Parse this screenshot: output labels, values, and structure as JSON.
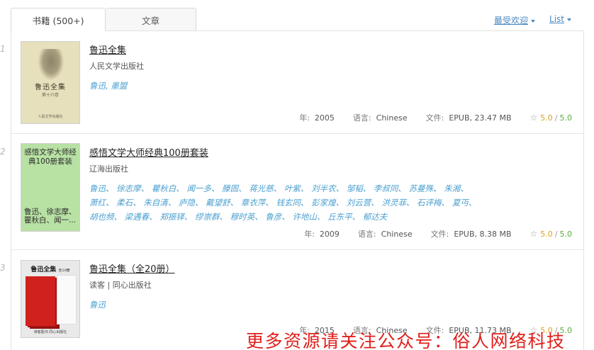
{
  "tabs": [
    {
      "label": "书籍 (500+)",
      "active": true
    },
    {
      "label": "文章",
      "active": false
    }
  ],
  "controls": {
    "sort_label": "最受欢迎",
    "view_label": "List"
  },
  "meta_labels": {
    "year": "年:",
    "language": "语言:",
    "file": "文件:"
  },
  "books": [
    {
      "index": "1",
      "title": "鲁迅全集",
      "publisher": "人民文学出版社",
      "authors": [
        "鲁迅",
        "墨盟"
      ],
      "year": "2005",
      "language": "Chinese",
      "file": "EPUB, 23.47 MB",
      "rating_a": "5.0",
      "rating_b": "5.0",
      "cover": {
        "title": "鲁迅全集",
        "subtitle": "第十六卷",
        "publisher": "人民文学出版社"
      }
    },
    {
      "index": "2",
      "title": "感悟文学大师经典100册套装",
      "publisher": "辽海出版社",
      "authors": [
        "鲁迅",
        "徐志摩",
        "瞿秋白",
        "闻一多",
        "滕固",
        "蒋光慈",
        "叶紫",
        "刘半农",
        "邹韬",
        "李叔同",
        "苏曼殊",
        "朱湘",
        "萧红",
        "柔石",
        "朱自清",
        "庐隐",
        "戴望舒",
        "章衣萍",
        "钱玄同",
        "彭家煌",
        "刘云营",
        "洪灵菲",
        "石评梅",
        "夏丏",
        "胡也频",
        "梁遇春",
        "郑振铎",
        "缪崇群",
        "穆时英",
        "鲁彦",
        "许地山",
        "丘东平",
        "郁达夫"
      ],
      "year": "2009",
      "language": "Chinese",
      "file": "EPUB, 8.38 MB",
      "rating_a": "5.0",
      "rating_b": "5.0",
      "cover": {
        "title": "感悟文学大师经典100册套装",
        "authors": "鲁迅、徐志摩、瞿秋白、闻一..."
      }
    },
    {
      "index": "3",
      "title": "鲁迅全集（全20册）",
      "publisher": "读客 | 同心出版社",
      "authors": [
        "鲁迅"
      ],
      "year": "2015",
      "language": "Chinese",
      "file": "EPUB, 11.73 MB",
      "rating_a": "5.0",
      "rating_b": "5.0",
      "cover": {
        "title": "鲁迅全集",
        "edition": "全20册",
        "publisher": "读客图书 同心出版社"
      }
    }
  ],
  "watermark": "更多资源请关注公众号：俗人网络科技"
}
